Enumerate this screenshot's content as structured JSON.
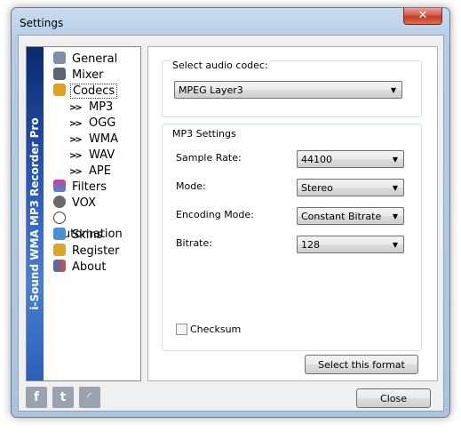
{
  "window": {
    "title": "Settings",
    "close_glyph": "✕"
  },
  "sidebar": {
    "product_name": "i-Sound WMA MP3 Recorder Pro",
    "items": [
      {
        "label": "General",
        "icon": "gear-icon"
      },
      {
        "label": "Mixer",
        "icon": "mixer-icon"
      },
      {
        "label": "Codecs",
        "icon": "codecs-icon",
        "selected": true
      },
      {
        "label": "Filters",
        "icon": "filters-icon"
      },
      {
        "label": "VOX",
        "icon": "vox-icon"
      },
      {
        "label": "Automation",
        "icon": "clock-icon"
      },
      {
        "label": "Skins",
        "icon": "skins-icon"
      },
      {
        "label": "Register",
        "icon": "lock-icon"
      },
      {
        "label": "About",
        "icon": "people-icon"
      }
    ],
    "codec_subitems": [
      "MP3",
      "OGG",
      "WMA",
      "WAV",
      "APE"
    ]
  },
  "codec": {
    "group_label": "Select audio codec:",
    "selected": "MPEG Layer3"
  },
  "mp3_settings": {
    "group_label": "MP3 Settings",
    "sample_rate_label": "Sample Rate:",
    "sample_rate": "44100",
    "mode_label": "Mode:",
    "mode": "Stereo",
    "encoding_label": "Encoding Mode:",
    "encoding": "Constant Bitrate",
    "bitrate_label": "Bitrate:",
    "bitrate": "128",
    "checksum_label": "Checksum",
    "checksum_checked": false
  },
  "buttons": {
    "select_format": "Select this format",
    "close": "Close"
  },
  "social": [
    {
      "glyph": "f",
      "icon": "facebook-icon"
    },
    {
      "glyph": "t",
      "icon": "twitter-icon"
    },
    {
      "glyph": "◜",
      "icon": "rss-icon"
    }
  ],
  "colors": {
    "accent_strip": "#2a57b8",
    "close_button": "#c23a26"
  }
}
